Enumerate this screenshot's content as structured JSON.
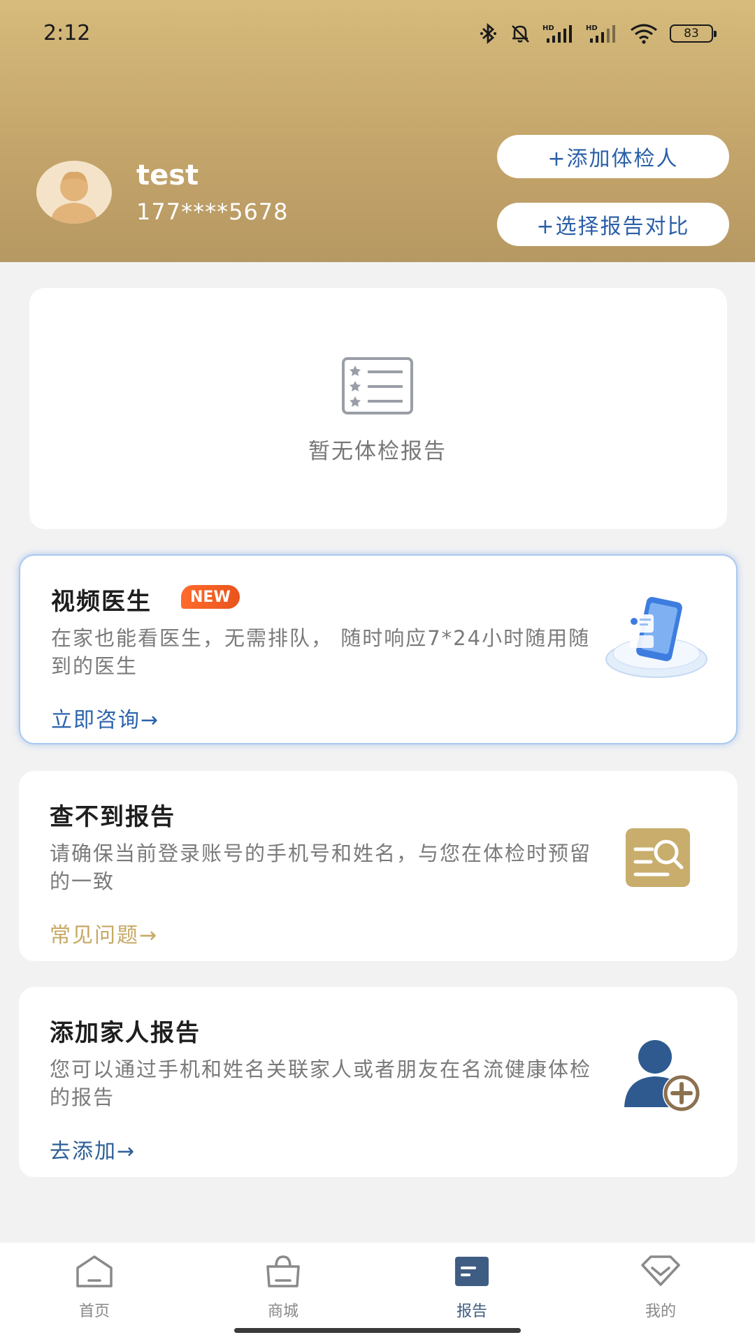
{
  "status_bar": {
    "time": "2:12",
    "battery": "83",
    "icons": [
      "bluetooth-icon",
      "mute-icon",
      "hd-signal-icon",
      "hd-signal-icon",
      "wifi-icon",
      "battery-icon"
    ]
  },
  "header": {
    "user_name": "test",
    "phone": "177****5678",
    "add_person_label": "+添加体检人",
    "compare_label": "+选择报告对比"
  },
  "empty_report": {
    "text": "暂无体检报告",
    "icon": "report-list-icon"
  },
  "cards": {
    "video_doctor": {
      "title": "视频医生",
      "badge": "NEW",
      "desc": "在家也能看医生，无需排队， 随时响应7*24小时随用随到的医生",
      "link": "立即咨询→",
      "icon": "phone-consult-illustration"
    },
    "report_lookup": {
      "title": "查不到报告",
      "desc": "请确保当前登录账号的手机号和姓名，与您在体检时预留的一致",
      "link": "常见问题→",
      "icon": "search-document-icon"
    },
    "family_report": {
      "title": "添加家人报告",
      "desc": "您可以通过手机和姓名关联家人或者朋友在名流健康体检的报告",
      "link": "去添加→",
      "icon": "add-user-icon"
    }
  },
  "tabbar": {
    "items": [
      {
        "label": "首页",
        "icon": "home-icon"
      },
      {
        "label": "商城",
        "icon": "shopping-bag-icon"
      },
      {
        "label": "报告",
        "icon": "report-icon",
        "active": true
      },
      {
        "label": "我的",
        "icon": "diamond-icon"
      }
    ]
  },
  "colors": {
    "header_gold": "#c4a56b",
    "link_blue": "#2b63ad",
    "link_gold": "#c7a863",
    "tab_active": "#3f5d82"
  }
}
